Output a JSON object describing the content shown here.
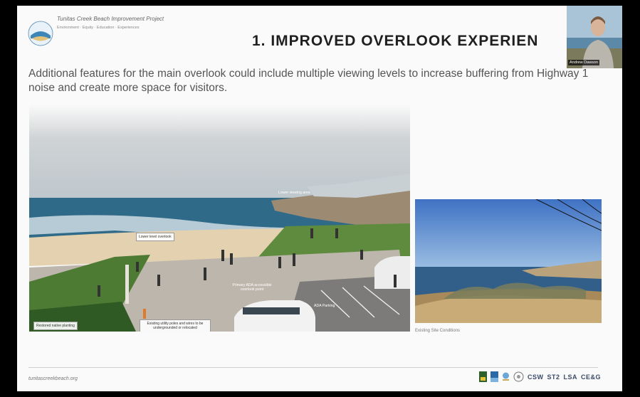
{
  "header": {
    "project_title": "Tunitas Creek Beach Improvement Project",
    "project_tagline": "Environment · Equity · Education · Experiences",
    "headline": "1. IMPROVED OVERLOOK EXPERIEN"
  },
  "video": {
    "participant_name": "Andrew Dawson"
  },
  "body": {
    "subtitle": "Additional features for the main overlook could include multiple viewing levels to increase buffering from Highway 1 noise and create more space for visitors."
  },
  "rendering": {
    "labels": {
      "lower_viewing_area": "Lower viewing area",
      "lower_level_overlook": "Lower level overlook",
      "primary_ada_point": "Primary ADA accessible overlook point",
      "ada_parking": "ADA Parking",
      "restored_planting": "Restored native planting",
      "utility_poles": "Existing utility poles and wires to be undergrounded or relocated"
    }
  },
  "photo": {
    "caption": "Existing Site Conditions"
  },
  "footer": {
    "url": "tunitascreekbeach.org",
    "partners": [
      "CSW",
      "ST2",
      "LSA",
      "CE&G"
    ]
  },
  "colors": {
    "headline": "#1f1f1f",
    "subtitle": "#555555",
    "partner_text": "#3b4a66"
  }
}
